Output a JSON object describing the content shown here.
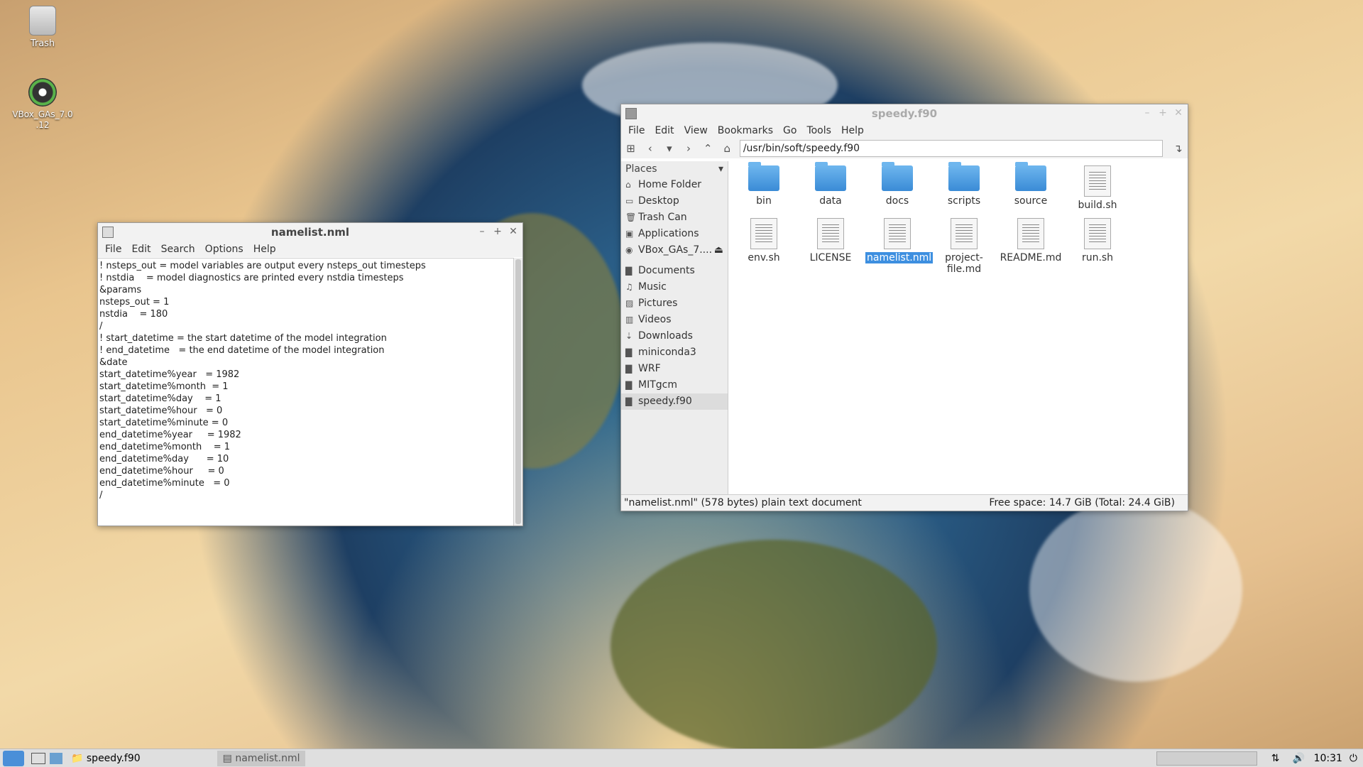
{
  "desktop": {
    "icons": [
      {
        "label": "Trash"
      },
      {
        "label": "VBox_GAs_7.0\n.12"
      }
    ]
  },
  "editor_window": {
    "title": "namelist.nml",
    "menu": [
      "File",
      "Edit",
      "Search",
      "Options",
      "Help"
    ],
    "lines": [
      "! nsteps_out = model variables are output every nsteps_out timesteps",
      "! nstdia    = model diagnostics are printed every nstdia timesteps",
      "&params",
      "nsteps_out = 1",
      "nstdia    = 180",
      "/",
      "! start_datetime = the start datetime of the model integration",
      "! end_datetime   = the end datetime of the model integration",
      "&date",
      "start_datetime%year   = 1982",
      "start_datetime%month  = 1",
      "start_datetime%day    = 1",
      "start_datetime%hour   = 0",
      "start_datetime%minute = 0",
      "end_datetime%year     = 1982",
      "end_datetime%month    = 1",
      "end_datetime%day      = 10",
      "end_datetime%hour     = 0",
      "end_datetime%minute   = 0",
      "/"
    ]
  },
  "file_manager": {
    "title": "speedy.f90",
    "menu": [
      "File",
      "Edit",
      "View",
      "Bookmarks",
      "Go",
      "Tools",
      "Help"
    ],
    "path": "/usr/bin/soft/speedy.f90",
    "places_header": "Places",
    "places": [
      {
        "label": "Home Folder",
        "icon": "home-icon"
      },
      {
        "label": "Desktop",
        "icon": "desktop-icon"
      },
      {
        "label": "Trash Can",
        "icon": "trash-icon"
      },
      {
        "label": "Applications",
        "icon": "applications-icon"
      },
      {
        "label": "VBox_GAs_7....",
        "icon": "disc-icon"
      },
      {
        "label": "Documents",
        "icon": "folder-icon"
      },
      {
        "label": "Music",
        "icon": "music-icon"
      },
      {
        "label": "Pictures",
        "icon": "pictures-icon"
      },
      {
        "label": "Videos",
        "icon": "videos-icon"
      },
      {
        "label": "Downloads",
        "icon": "downloads-icon"
      },
      {
        "label": "miniconda3",
        "icon": "folder-icon"
      },
      {
        "label": "WRF",
        "icon": "folder-icon"
      },
      {
        "label": "MITgcm",
        "icon": "folder-icon"
      },
      {
        "label": "speedy.f90",
        "icon": "folder-icon"
      }
    ],
    "files": [
      {
        "name": "bin",
        "type": "folder"
      },
      {
        "name": "data",
        "type": "folder"
      },
      {
        "name": "docs",
        "type": "folder"
      },
      {
        "name": "scripts",
        "type": "folder"
      },
      {
        "name": "source",
        "type": "folder"
      },
      {
        "name": "build.sh",
        "type": "file"
      },
      {
        "name": "env.sh",
        "type": "file"
      },
      {
        "name": "LICENSE",
        "type": "file"
      },
      {
        "name": "namelist.nml",
        "type": "file",
        "selected": true
      },
      {
        "name": "project-\nfile.md",
        "type": "file"
      },
      {
        "name": "README.md",
        "type": "file"
      },
      {
        "name": "run.sh",
        "type": "file"
      }
    ],
    "status_left": "\"namelist.nml\" (578 bytes) plain text document",
    "status_right": "Free space: 14.7 GiB (Total: 24.4 GiB)"
  },
  "taskbar": {
    "tasks": [
      "speedy.f90",
      "namelist.nml"
    ],
    "clock": "10:31"
  }
}
